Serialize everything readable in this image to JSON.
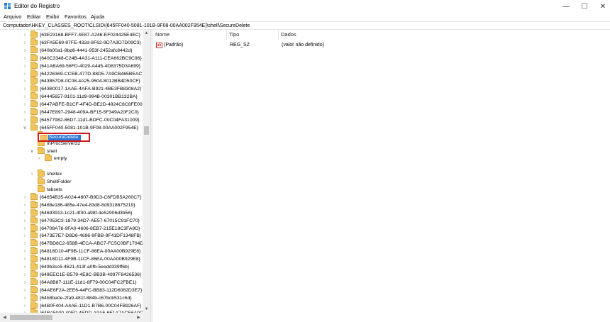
{
  "window": {
    "title": "Editor do Registro"
  },
  "menu": [
    "Arquivo",
    "Editar",
    "Exibir",
    "Favoritos",
    "Ajuda"
  ],
  "address": "Computador\\HKEY_CLASSES_ROOT\\CLSID\\{645FF040-5081-101B-9F08-00AA002F954E}\\shell\\SecureDelete",
  "tree": {
    "top_items": [
      "{63E23168-BFF7-4E87-A246-EF024425E4EC}",
      "{63FA5E69-87FE-432d-8F62-9D7A3D7D09C3}",
      "{640b00a1-8bd6-4441-953f-2452afc8442d}",
      "{640C3348-C24B-4A31-A111-CEA662BC9C96}",
      "{641ABA69-56FD-4029-A445-4D8375D3A699}",
      "{64226369-CCEB-477D-88D5-7A9CB465BEAC}",
      "{643857D8-0C08-4A25-9504-8012BB4D50CF}",
      "{643B0017-1AAE-4AFA-B921-4BE3FB8308A2}",
      "{64445657-9101-11d9-994B-00301BB132BA}",
      "{6447ABFE-B1CF-4F4D-BE2D-4924C8C8FE00}",
      "{6447E897-2948-409A-BF15-5F349A20F2C0}",
      "{64577982-86D7-11d1-BDFC-00C04FA31009}"
    ],
    "recycle_key": "{645FF040-5081-101B-9F08-00AA002F954E}",
    "recycle_children": [
      "DefaultIcon",
      "InProcServer32"
    ],
    "shell_key": "shell",
    "shell_children": [
      "empty"
    ],
    "new_key": "SecureDelete",
    "after_shell": [
      "shellex",
      "ShellFolder",
      "tabsets"
    ],
    "bottom_items": [
      "{64654B35-A024-4807-B9D3-C6FDB5A260C7}",
      "{6468e186-485e-47e4-83d8-8d9318675219}",
      "{64693913-1c21-4f30-a98f-4e52906d3b56}",
      "{647053C3-1879-34D7-AE57-67015C91FC70}",
      "{64708A78-9FA0-4606-8EB7-215E18C3FA9D}",
      "{6473E7E7-D8D6-4696-9FBB-9F41DF1348FB}",
      "{647BD8C2-658B-4ECA-ABC7-FC5C0BF1704D}",
      "{64818D10-4F9B-11CF-86EA-00AA00B929E8}",
      "{64818D11-4F9B-11CF-86EA-00AA00B929E8}",
      "{649b3cc6-4621-413f-a0fb-5eedd339ff6b}",
      "{649EEC1E-B579-4E8C-BB3B-4997F8426536}",
      "{64A8B87-111E-11d1-8F79-00C04FC2FBE1}",
      "{64AE6F2A-2EE6-44FC-BB83-112D6082D3E7}",
      "{64b8ba0e-2fa9-481f-884b-c67bcb531c6d}",
      "{64B0F404-A4AE-11D1-B7B6-00C04FB926AF}",
      "{64BA5000-40FD-4EDD-A9A6-6E1A7ACE6A0C7}"
    ]
  },
  "list": {
    "columns": [
      "Nome",
      "Tipo",
      "Dados"
    ],
    "rows": [
      {
        "name": "(Padrão)",
        "type": "REG_SZ",
        "data": "(valor não definido)",
        "icon": "string-value-icon"
      }
    ]
  }
}
